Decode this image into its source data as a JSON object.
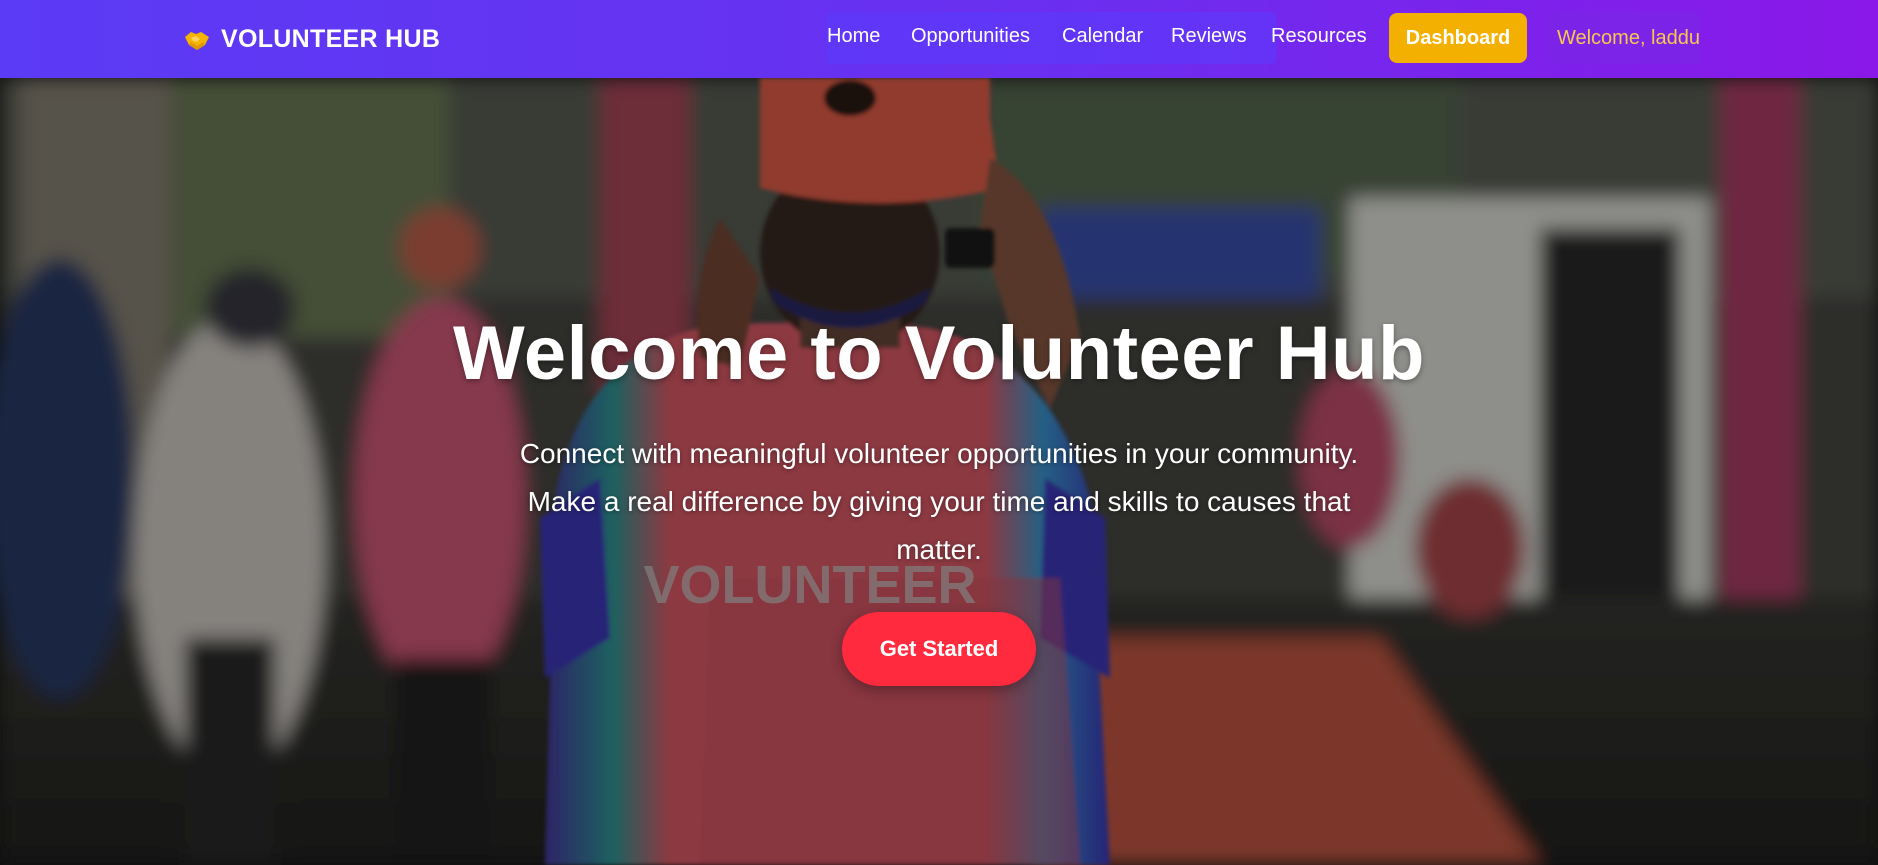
{
  "navbar": {
    "brand_icon": "handshake-icon",
    "brand_name": "VOLUNTEER HUB",
    "links": [
      {
        "label": "Home"
      },
      {
        "label": "Opportunities"
      },
      {
        "label": "Calendar"
      },
      {
        "label": "Reviews"
      },
      {
        "label": "Resources"
      }
    ],
    "dashboard_label": "Dashboard",
    "welcome_text": "Welcome, laddu"
  },
  "hero": {
    "title": "Welcome to Volunteer Hub",
    "subtitle_line1": "Connect with meaningful volunteer opportunities in your community.",
    "subtitle_line2": "Make a real difference by giving your time and skills to causes that",
    "subtitle_line3": "matter.",
    "cta_label": "Get Started",
    "shirt_text": "VOLUNTEER"
  },
  "colors": {
    "nav_gradient_start": "#5b3bf5",
    "nav_gradient_end": "#8a18e8",
    "dashboard_button": "#f4b000",
    "welcome_text": "#f9c74f",
    "cta_button": "#ff2a3d"
  }
}
